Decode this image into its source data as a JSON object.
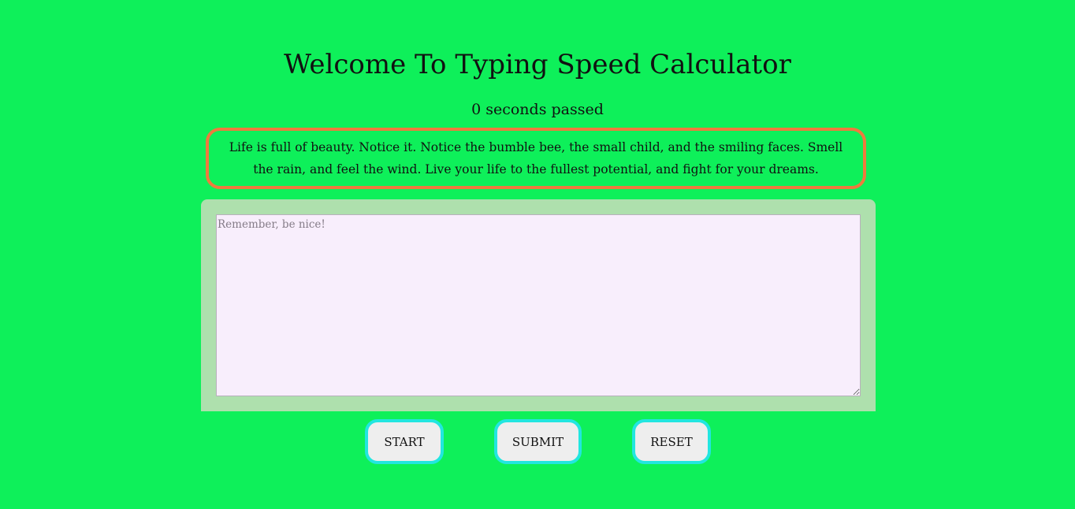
{
  "header": {
    "title": "Welcome To Typing Speed Calculator",
    "timer_text": "0 seconds passed"
  },
  "quote": {
    "text": "Life is full of beauty. Notice it. Notice the bumble bee, the small child, and the smiling faces. Smell the rain, and feel the wind. Live your life to the fullest potential, and fight for your dreams."
  },
  "input": {
    "value": "",
    "placeholder": "Remember, be nice!"
  },
  "buttons": {
    "start_label": "START",
    "submit_label": "SUBMIT",
    "reset_label": "RESET"
  },
  "colors": {
    "background": "#0ef05a",
    "quote_border": "#ef7a3e",
    "panel": "#aee0ad",
    "textarea_bg": "#f8eefc",
    "button_border": "#22e6e0",
    "button_bg": "#eeeeee"
  }
}
